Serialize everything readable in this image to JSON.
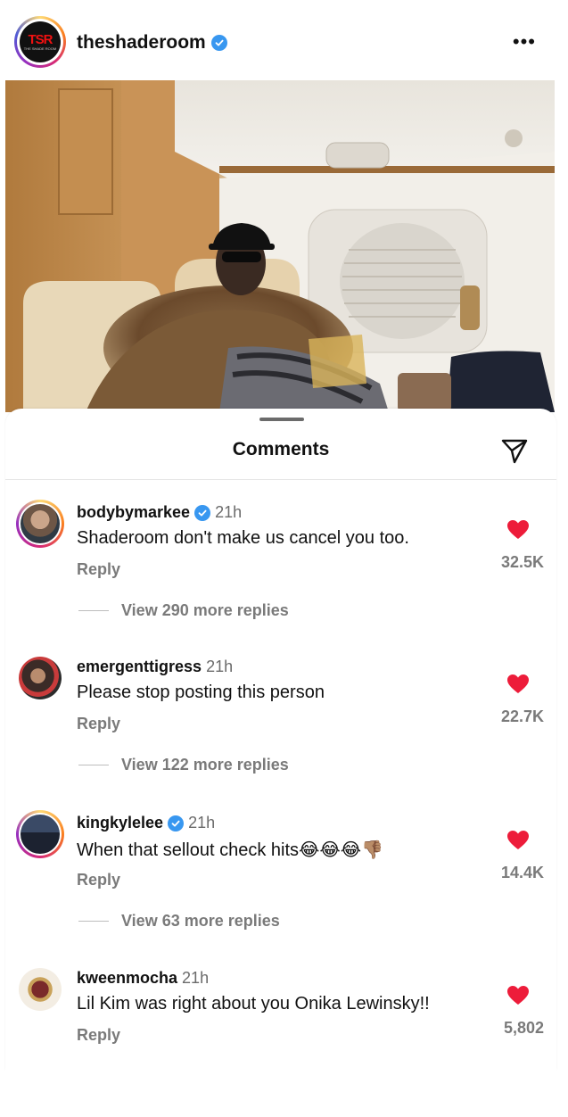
{
  "post": {
    "username": "theshaderoom",
    "verified": true,
    "logo_text": "TSR",
    "logo_subtext": "THE SHADE ROOM"
  },
  "sheet": {
    "title": "Comments"
  },
  "comments": [
    {
      "username": "bodybymarkee",
      "verified": true,
      "time": "21h",
      "text": "Shaderoom don't make us cancel you too.",
      "reply": "Reply",
      "likes": "32.5K",
      "view_replies": "View 290 more replies"
    },
    {
      "username": "emergenttigress",
      "verified": false,
      "time": "21h",
      "text": "Please stop posting this person",
      "reply": "Reply",
      "likes": "22.7K",
      "view_replies": "View 122 more replies"
    },
    {
      "username": "kingkylelee",
      "verified": true,
      "time": "21h",
      "text": "When that sellout check hits😂😂😂👎🏽",
      "reply": "Reply",
      "likes": "14.4K",
      "view_replies": "View 63 more replies"
    },
    {
      "username": "kweenmocha",
      "verified": false,
      "time": "21h",
      "text": "Lil Kim was right about you Onika Lewinsky!!",
      "reply": "Reply",
      "likes": "5,802",
      "view_replies": ""
    }
  ],
  "colors": {
    "heart": "#ed1c3a",
    "verified": "#3897f0",
    "muted": "#7a7a7a"
  },
  "icons": [
    "more-icon",
    "verified-icon",
    "send-icon",
    "heart-icon"
  ]
}
